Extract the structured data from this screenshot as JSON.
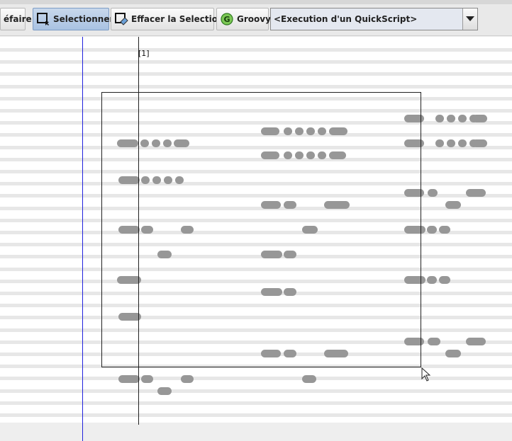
{
  "toolbar": {
    "undo_label": "éfaire",
    "select_label": "Selectionner",
    "clear_selection_label": "Effacer la Selection",
    "groovy_label": "Groovy",
    "groovy_icon_letter": "G",
    "quickscript_value": "<Execution d'un QuickScript>"
  },
  "score": {
    "measure_marker": "[1]"
  },
  "colors": {
    "selected_button": "#a9c2e2",
    "cursor_line": "#2222dd",
    "note": "#979797",
    "groovy_icon": "#4aa832"
  },
  "icons": [
    "select-icon",
    "clear-selection-icon",
    "groovy-icon",
    "dropdown-arrow-icon",
    "mouse-cursor-icon"
  ]
}
